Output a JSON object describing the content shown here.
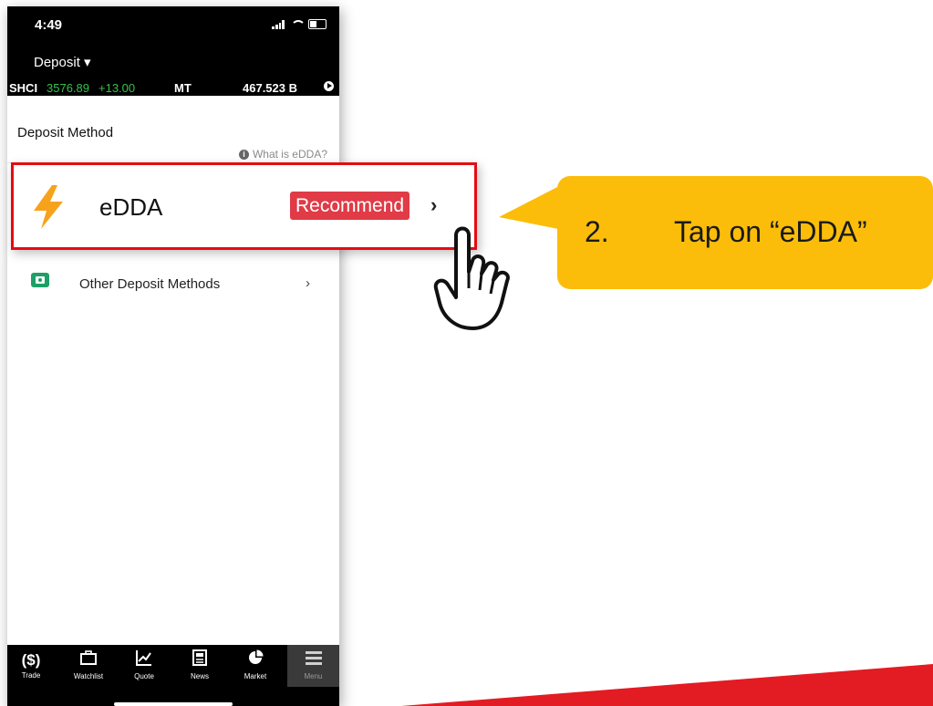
{
  "status_bar": {
    "time": "4:49"
  },
  "nav": {
    "title": "Deposit ▾"
  },
  "ticker": {
    "index": "SHCI",
    "value": "3576.89",
    "change": "+13.00",
    "label": "MT",
    "turnover": "467.523 B"
  },
  "deposit": {
    "section_title": "Deposit Method",
    "what_is": "What is eDDA?",
    "edda_label": "eDDA",
    "recommend_badge": "Recommend",
    "edda_chevron": "›",
    "other_label": "Other Deposit Methods",
    "other_chevron": "›"
  },
  "tabbar": {
    "tabs": [
      {
        "label": "Trade",
        "icon": "dollar-icon"
      },
      {
        "label": "Watchlist",
        "icon": "briefcase-icon"
      },
      {
        "label": "Quote",
        "icon": "line-chart-icon"
      },
      {
        "label": "News",
        "icon": "newspaper-icon"
      },
      {
        "label": "Market",
        "icon": "pie-chart-icon"
      },
      {
        "label": "Menu",
        "icon": "hamburger-icon"
      }
    ],
    "active": "Menu"
  },
  "callout": {
    "number": "2.",
    "text": "Tap on “eDDA”"
  },
  "colors": {
    "highlight_border": "#e30c12",
    "badge": "#e03b46",
    "callout": "#fbbd0a",
    "bolt": "#f7a21b",
    "ticker_green": "#35c24b",
    "money_icon": "#1ca067"
  }
}
